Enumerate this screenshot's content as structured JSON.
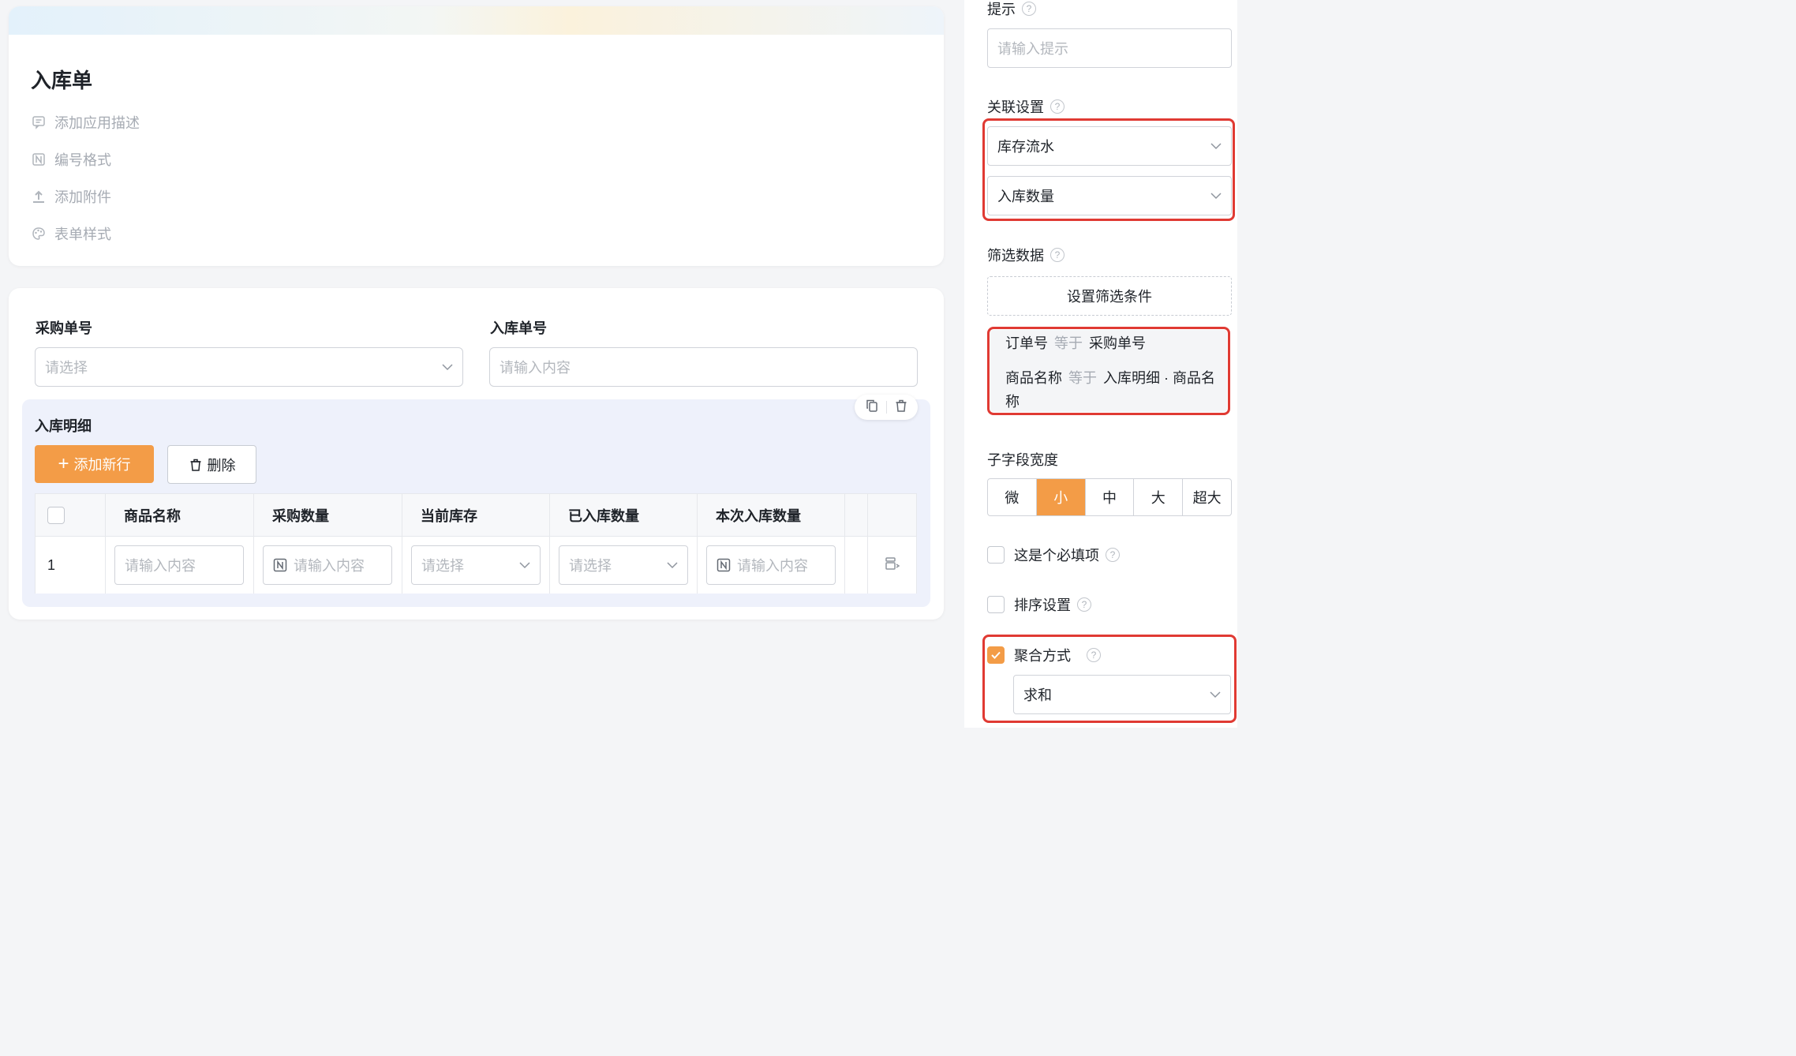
{
  "form": {
    "title": "入库单",
    "meta": [
      {
        "label": "添加应用描述",
        "icon": "comment-icon"
      },
      {
        "label": "编号格式",
        "icon": "number-format-icon"
      },
      {
        "label": "添加附件",
        "icon": "upload-icon"
      },
      {
        "label": "表单样式",
        "icon": "palette-icon"
      }
    ],
    "fields": {
      "purchase_no": {
        "label": "采购单号",
        "placeholder": "请选择"
      },
      "inbound_no": {
        "label": "入库单号",
        "placeholder": "请输入内容"
      }
    },
    "detail": {
      "title": "入库明细",
      "add_label": "添加新行",
      "delete_label": "删除",
      "columns": [
        "商品名称",
        "采购数量",
        "当前库存",
        "已入库数量",
        "本次入库数量"
      ],
      "row": {
        "index": "1",
        "cells": [
          "请输入内容",
          "请输入内容",
          "请选择",
          "请选择",
          "请输入内容"
        ]
      }
    }
  },
  "panel": {
    "hint_label": "提示",
    "hint_placeholder": "请输入提示",
    "relation_label": "关联设置",
    "relation_table": "库存流水",
    "relation_field": "入库数量",
    "filter_label": "筛选数据",
    "filter_button": "设置筛选条件",
    "conditions": [
      {
        "field": "订单号",
        "op": "等于",
        "value": "采购单号"
      },
      {
        "field": "商品名称",
        "op": "等于",
        "value": "入库明细 · 商品名称"
      }
    ],
    "width_label": "子字段宽度",
    "width_options": [
      "微",
      "小",
      "中",
      "大",
      "超大"
    ],
    "width_selected": "小",
    "required_label": "这是个必填项",
    "sort_label": "排序设置",
    "aggregate_label": "聚合方式",
    "aggregate_checked": true,
    "aggregate_value": "求和"
  },
  "colors": {
    "accent": "#f39c47",
    "highlight": "#e03a33"
  }
}
